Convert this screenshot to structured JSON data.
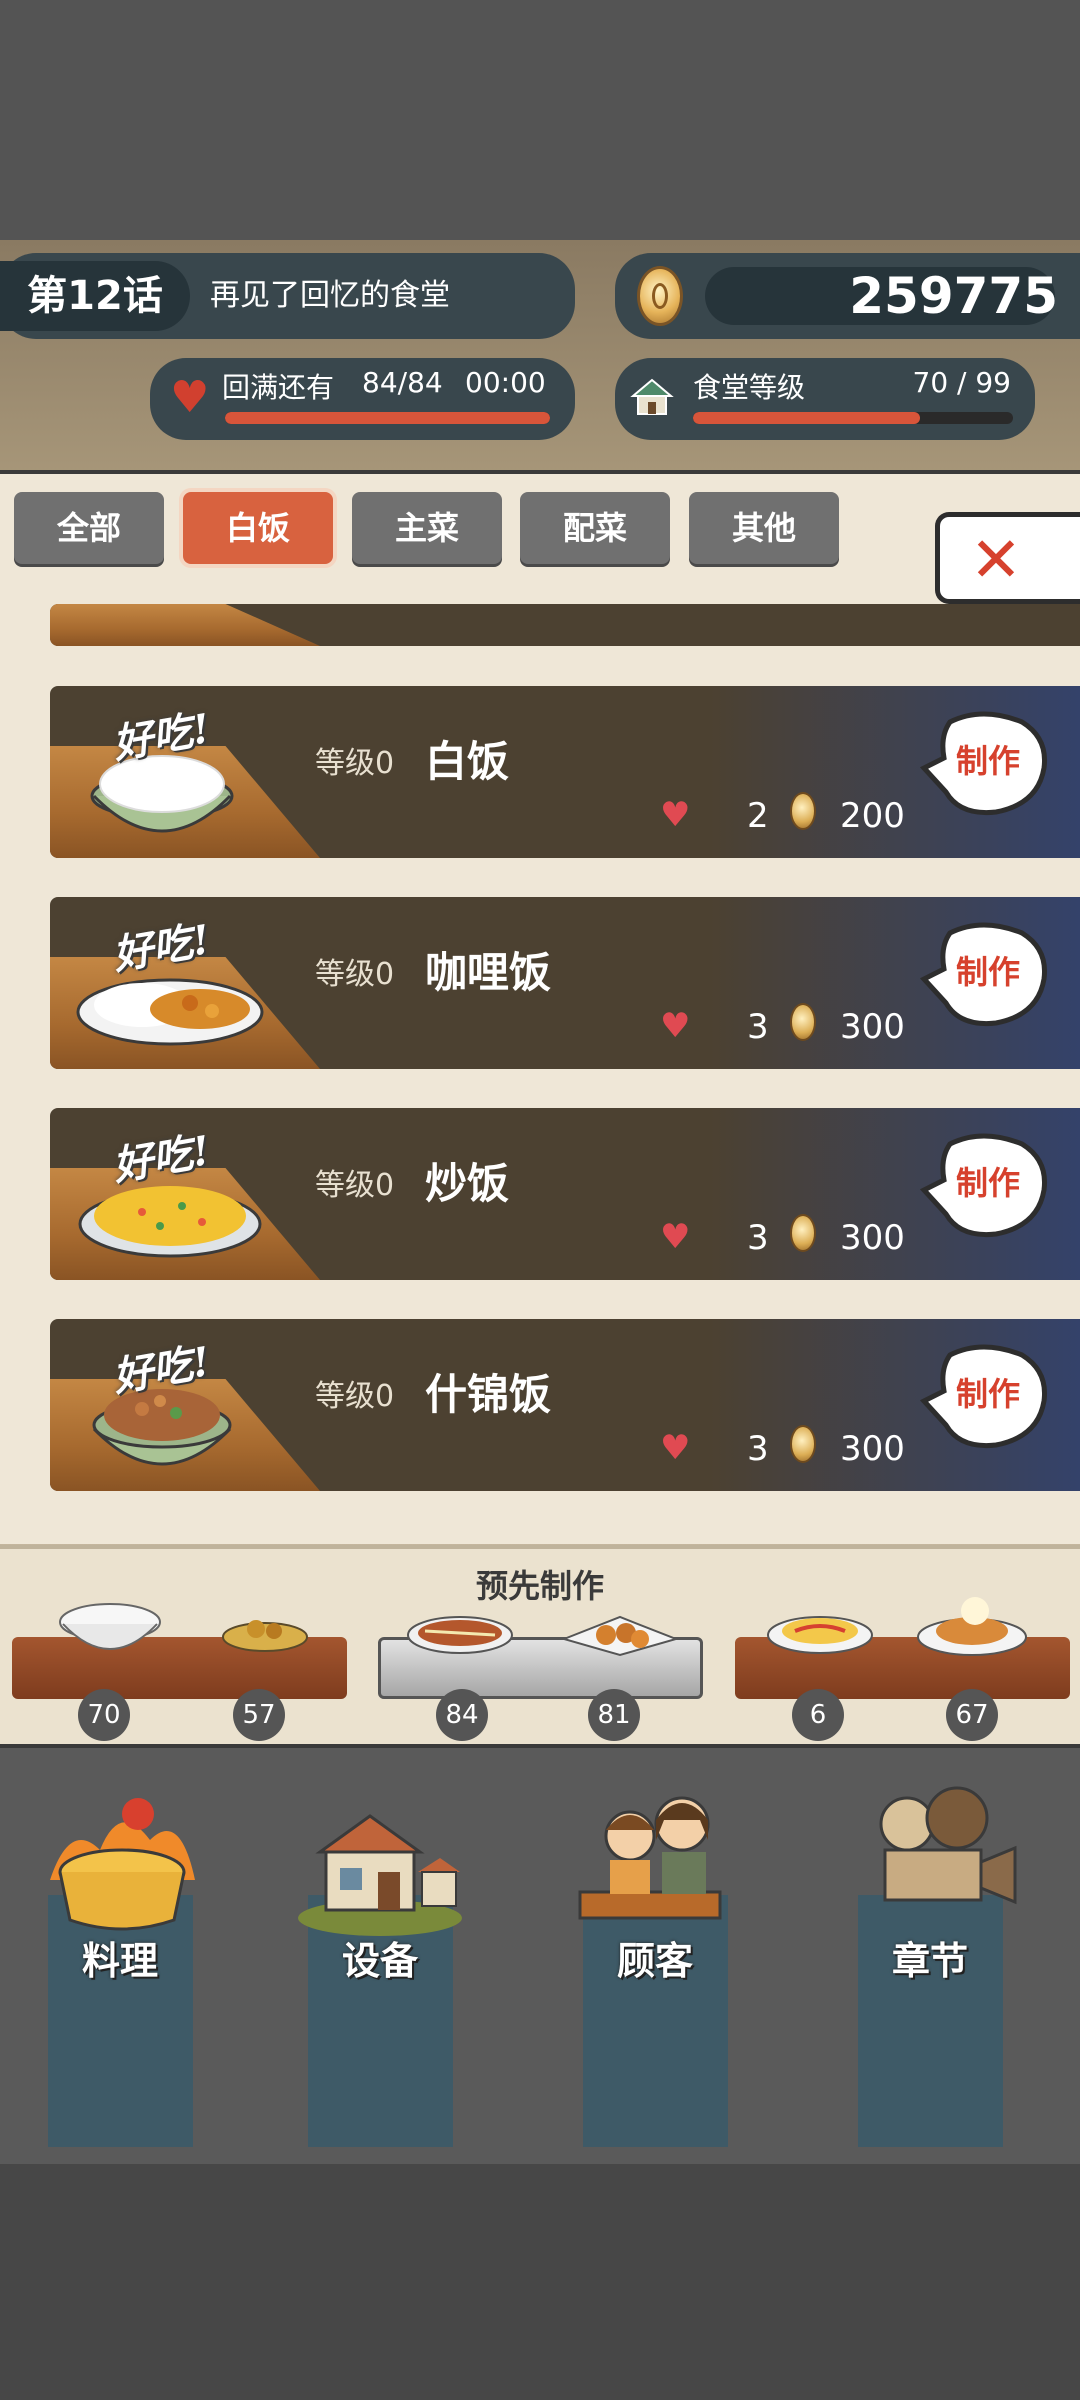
{
  "header": {
    "chapter_num": "第12话",
    "chapter_title": "再见了回忆的食堂",
    "coins": "259775",
    "stamina_label": "回满还有",
    "stamina_value": "84/84",
    "stamina_timer": "00:00",
    "stamina_fraction": 1.0,
    "level_label": "食堂等级",
    "level_value": "70 / 99",
    "level_fraction": 0.71
  },
  "tabs": [
    {
      "label": "全部",
      "active": false
    },
    {
      "label": "白饭",
      "active": true
    },
    {
      "label": "主菜",
      "active": false
    },
    {
      "label": "配菜",
      "active": false
    },
    {
      "label": "其他",
      "active": false
    }
  ],
  "recipes": [
    {
      "tag": "好吃!",
      "level": "等级0",
      "name": "白饭",
      "hearts": "2",
      "cost": "200",
      "button": "制作",
      "icon": "white-rice-icon"
    },
    {
      "tag": "好吃!",
      "level": "等级0",
      "name": "咖哩饭",
      "hearts": "3",
      "cost": "300",
      "button": "制作",
      "icon": "curry-rice-icon"
    },
    {
      "tag": "好吃!",
      "level": "等级0",
      "name": "炒饭",
      "hearts": "3",
      "cost": "300",
      "button": "制作",
      "icon": "fried-rice-icon"
    },
    {
      "tag": "好吃!",
      "level": "等级0",
      "name": "什锦饭",
      "hearts": "3",
      "cost": "300",
      "button": "制作",
      "icon": "mixed-rice-icon"
    }
  ],
  "premade": {
    "title": "预先制作",
    "counts": [
      "70",
      "57",
      "84",
      "81",
      "6",
      "67"
    ]
  },
  "nav": [
    {
      "label": "料理",
      "icon": "cooking-pot-icon"
    },
    {
      "label": "设备",
      "icon": "restaurant-building-icon"
    },
    {
      "label": "顾客",
      "icon": "customers-icon"
    },
    {
      "label": "章节",
      "icon": "film-projector-icon"
    }
  ],
  "colors": {
    "accent": "#d8623f",
    "panel": "#efe7d7",
    "header": "#39474d",
    "nav": "#3e5a67",
    "heart": "#e04a52"
  }
}
